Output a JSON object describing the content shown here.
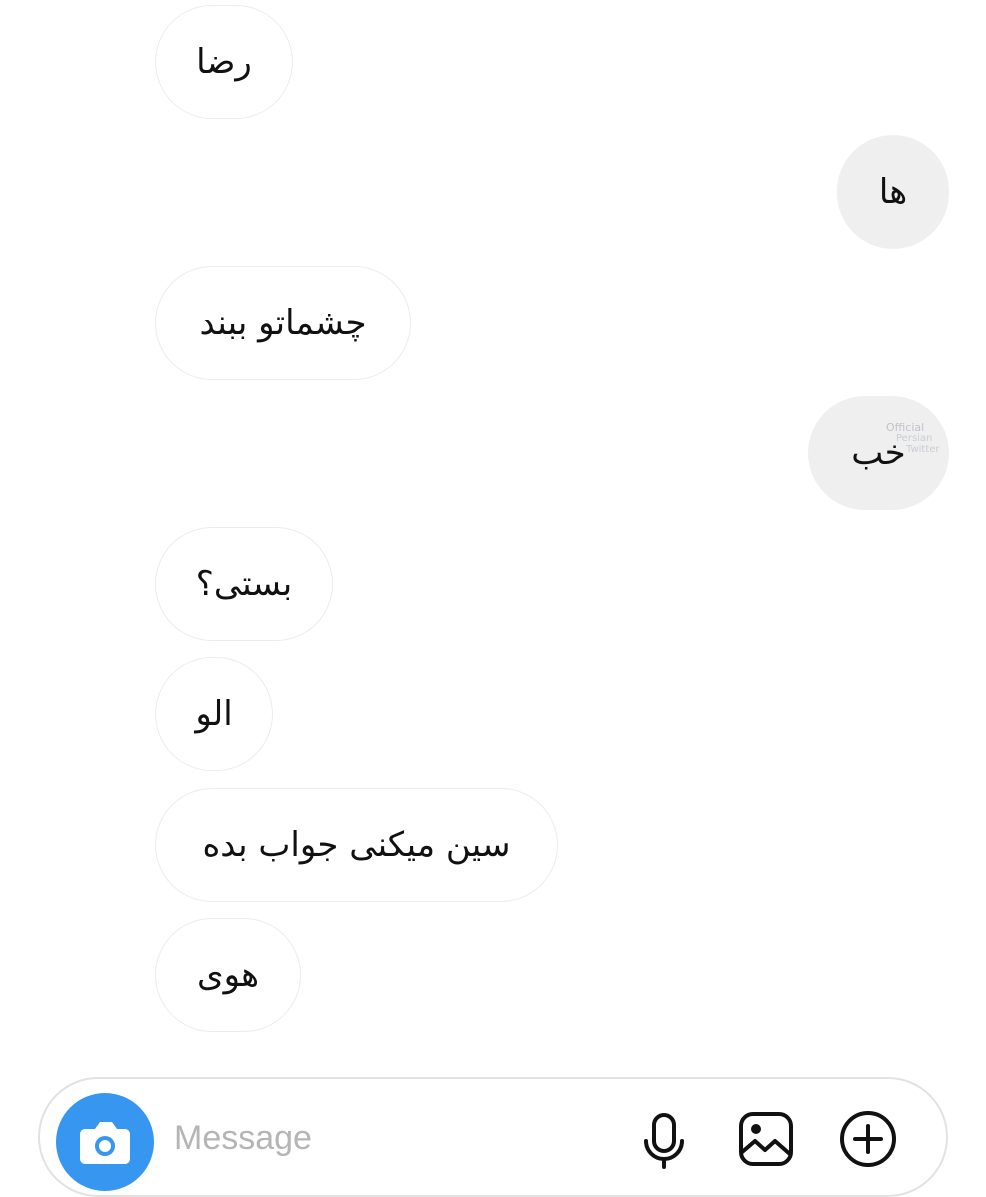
{
  "thread": {
    "messages": [
      {
        "sender": "them",
        "text": "رضا"
      },
      {
        "sender": "me",
        "text": "ها"
      },
      {
        "sender": "them",
        "text": "چشماتو ببند"
      },
      {
        "sender": "me",
        "text": "خب"
      },
      {
        "sender": "them",
        "text": "بستی؟"
      },
      {
        "sender": "them",
        "text": "الو"
      },
      {
        "sender": "them",
        "text": "سین میکنی جواب بده"
      },
      {
        "sender": "them",
        "text": "هوی"
      }
    ]
  },
  "watermark": {
    "line1": "Official",
    "line2": "Persian",
    "line3": "Twitter"
  },
  "composer": {
    "placeholder": "Message",
    "value": ""
  },
  "icons": {
    "camera": "camera-icon",
    "microphone": "microphone-icon",
    "gallery": "gallery-icon",
    "add": "plus-circle-icon"
  },
  "colors": {
    "accent": "#3797f0",
    "incoming_bubble": "#ffffff",
    "incoming_border": "#ececec",
    "outgoing_bubble": "#efefef",
    "text": "#111111",
    "placeholder": "#b5b5b5"
  }
}
